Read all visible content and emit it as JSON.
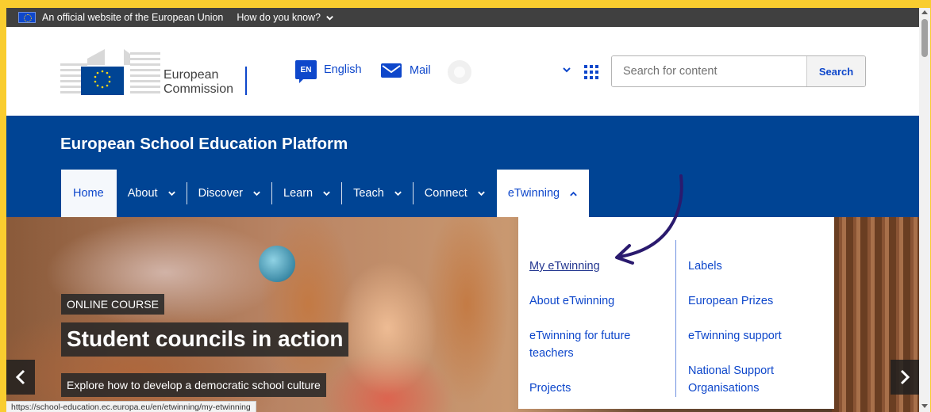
{
  "eu_bar": {
    "official_text": "An official website of the European Union",
    "how_know_text": "How do you know?"
  },
  "header": {
    "logo_line1": "European",
    "logo_line2": "Commission",
    "language_code": "EN",
    "language_label": "English",
    "mail_label": "Mail",
    "search_placeholder": "Search for content",
    "search_button": "Search"
  },
  "band": {
    "site_title": "European School Education Platform"
  },
  "nav": {
    "items": [
      {
        "label": "Home"
      },
      {
        "label": "About"
      },
      {
        "label": "Discover"
      },
      {
        "label": "Learn"
      },
      {
        "label": "Teach"
      },
      {
        "label": "Connect"
      },
      {
        "label": "eTwinning"
      }
    ]
  },
  "dropdown": {
    "left": [
      {
        "label": "My eTwinning"
      },
      {
        "label": "About eTwinning"
      },
      {
        "label": "eTwinning for future teachers"
      },
      {
        "label": "Projects"
      }
    ],
    "right": [
      {
        "label": "Labels"
      },
      {
        "label": "European Prizes"
      },
      {
        "label": "eTwinning support"
      },
      {
        "label": "National Support Organisations"
      }
    ]
  },
  "hero": {
    "tag": "ONLINE COURSE",
    "title": "Student councils in action",
    "subtitle": "Explore how to develop a democratic school culture"
  },
  "status_url": "https://school-education.ec.europa.eu/en/etwinning/my-etwinning",
  "colors": {
    "frame": "#f9cd2f",
    "eu_blue": "#004494",
    "link_blue": "#0e47cb",
    "annotation_arrow": "#2a1a6e"
  }
}
